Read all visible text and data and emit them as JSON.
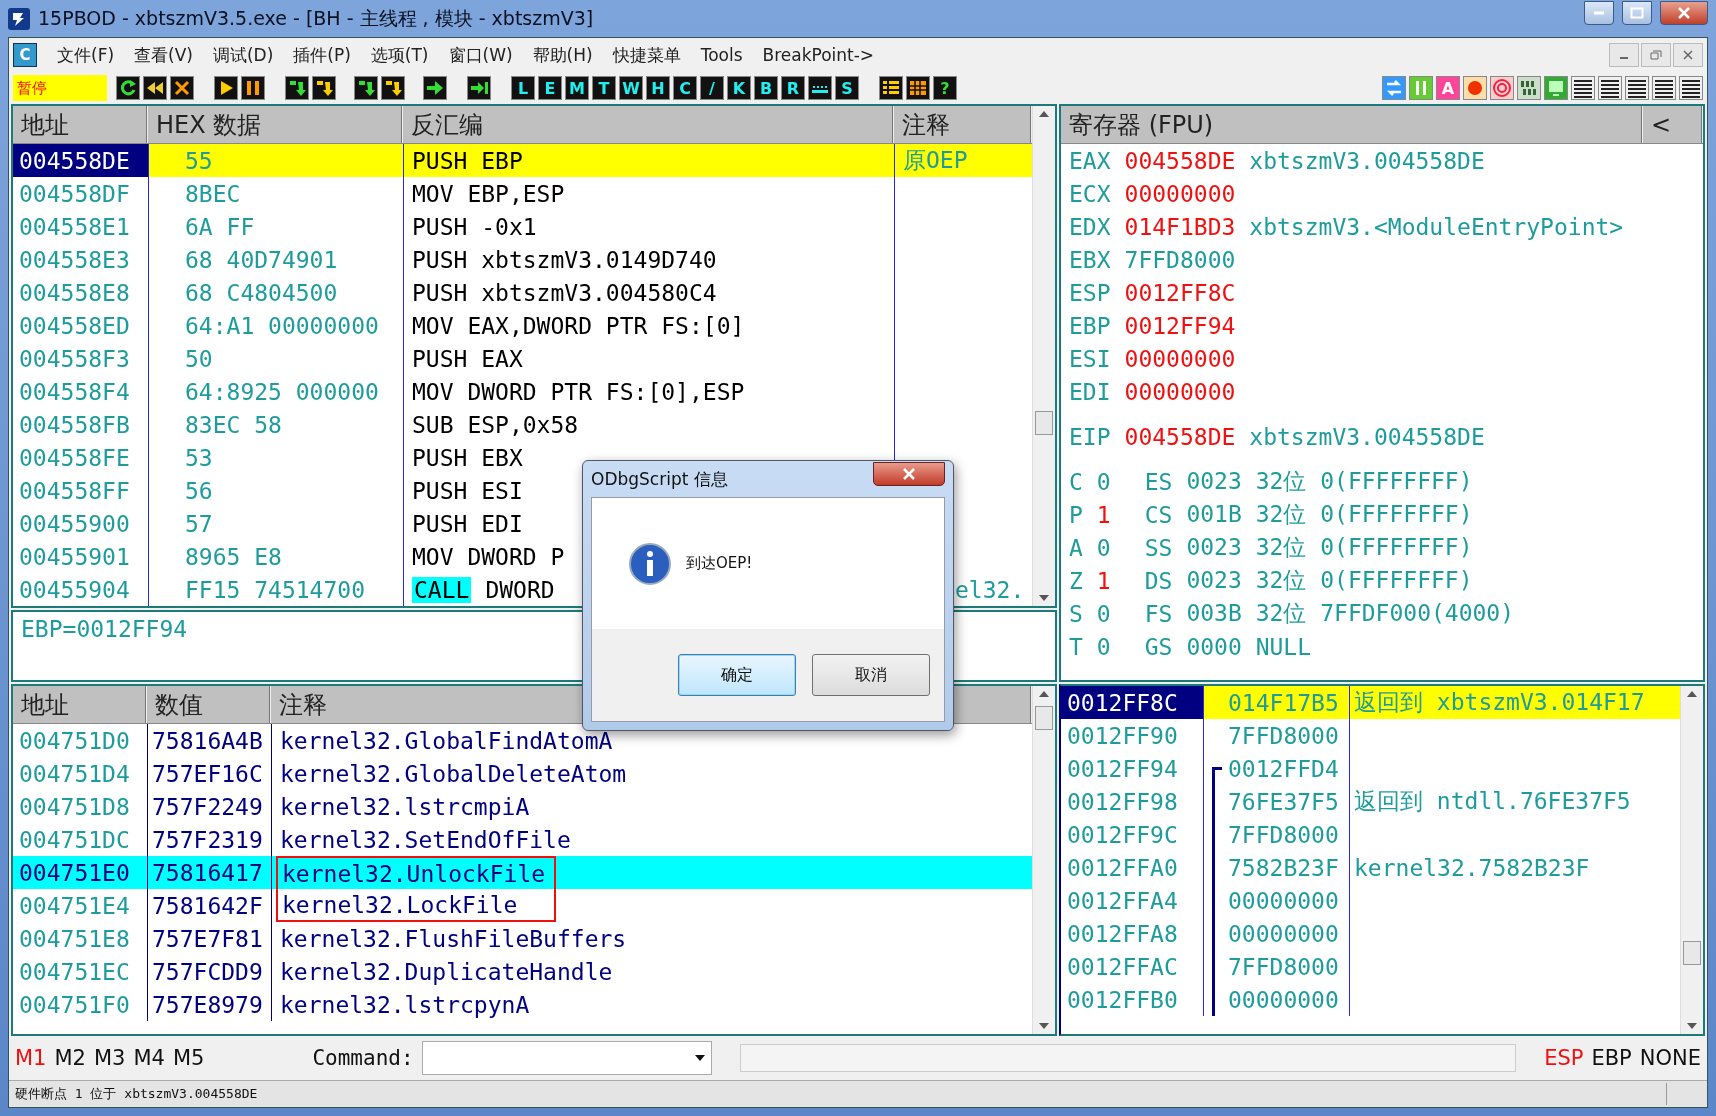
{
  "window": {
    "title": "15PBOD  - xbtszmV3.5.exe - [BH - 主线程 , 模块 - xbtszmV3]"
  },
  "menu": {
    "app_icon": "C",
    "items": [
      "文件(F)",
      "查看(V)",
      "调试(D)",
      "插件(P)",
      "选项(T)",
      "窗口(W)",
      "帮助(H)",
      "快捷菜单",
      "Tools",
      "BreakPoint->"
    ]
  },
  "toolbar": {
    "status": "暂停",
    "letters": [
      "L",
      "E",
      "M",
      "T",
      "W",
      "H",
      "C",
      "/",
      "K",
      "B",
      "R",
      "S"
    ],
    "help": "?",
    "right_letter": "A"
  },
  "disassembly": {
    "columns": [
      "地址",
      "HEX 数据",
      "反汇编",
      "注释"
    ],
    "rows": [
      {
        "address": "004558DE",
        "hex": "55",
        "disasm": "PUSH EBP",
        "comment": "原OEP",
        "selected": true
      },
      {
        "address": "004558DF",
        "hex": "8BEC",
        "disasm": "MOV EBP,ESP",
        "selected": false
      },
      {
        "address": "004558E1",
        "hex": "6A FF",
        "disasm": "PUSH -0x1",
        "selected": false
      },
      {
        "address": "004558E3",
        "hex": "68 40D74901",
        "disasm": "PUSH xbtszmV3.0149D740",
        "selected": false
      },
      {
        "address": "004558E8",
        "hex": "68 C4804500",
        "disasm": "PUSH xbtszmV3.004580C4",
        "selected": false
      },
      {
        "address": "004558ED",
        "hex": "64:A1 00000000",
        "disasm": "MOV EAX,DWORD PTR FS:[0]",
        "selected": false
      },
      {
        "address": "004558F3",
        "hex": "50",
        "disasm": "PUSH EAX",
        "selected": false
      },
      {
        "address": "004558F4",
        "hex": "64:8925 000000",
        "disasm": "MOV DWORD PTR FS:[0],ESP",
        "selected": false
      },
      {
        "address": "004558FB",
        "hex": "83EC 58",
        "disasm": "SUB ESP,0x58",
        "selected": false
      },
      {
        "address": "004558FE",
        "hex": "53",
        "disasm": "PUSH EBX",
        "selected": false
      },
      {
        "address": "004558FF",
        "hex": "56",
        "disasm": "PUSH ESI",
        "selected": false
      },
      {
        "address": "00455900",
        "hex": "57",
        "disasm": "PUSH EDI",
        "selected": false
      },
      {
        "address": "00455901",
        "hex": "8965 E8",
        "disasm": "MOV DWORD P",
        "selected": false
      },
      {
        "address": "00455904",
        "hex": "FF15 74514700",
        "opcode": "CALL",
        "disasm": "DWORD",
        "comment": "el32.",
        "selected": false
      }
    ]
  },
  "info": "EBP=0012FF94",
  "registers": {
    "header": "寄存器 (FPU)",
    "collapse": "<",
    "general": [
      {
        "name": "EAX",
        "value": "004558DE",
        "changed": true,
        "comment": "xbtszmV3.004558DE"
      },
      {
        "name": "ECX",
        "value": "00000000",
        "changed": true
      },
      {
        "name": "EDX",
        "value": "014F1BD3",
        "changed": true,
        "comment": "xbtszmV3.<ModuleEntryPoint>"
      },
      {
        "name": "EBX",
        "value": "7FFD8000",
        "changed": false
      },
      {
        "name": "ESP",
        "value": "0012FF8C",
        "changed": true
      },
      {
        "name": "EBP",
        "value": "0012FF94",
        "changed": true
      },
      {
        "name": "ESI",
        "value": "00000000",
        "changed": true
      },
      {
        "name": "EDI",
        "value": "00000000",
        "changed": true
      }
    ],
    "eip": {
      "name": "EIP",
      "value": "004558DE",
      "changed": true,
      "comment": "xbtszmV3.004558DE"
    },
    "flags": [
      {
        "flag": "C",
        "value": "0",
        "changed": false,
        "segment": "ES",
        "detail": "0023 32位 0(FFFFFFFF)"
      },
      {
        "flag": "P",
        "value": "1",
        "changed": true,
        "segment": "CS",
        "detail": "001B 32位 0(FFFFFFFF)"
      },
      {
        "flag": "A",
        "value": "0",
        "changed": false,
        "segment": "SS",
        "detail": "0023 32位 0(FFFFFFFF)"
      },
      {
        "flag": "Z",
        "value": "1",
        "changed": true,
        "segment": "DS",
        "detail": "0023 32位 0(FFFFFFFF)"
      },
      {
        "flag": "S",
        "value": "0",
        "changed": false,
        "segment": "FS",
        "detail": "003B 32位 7FFDF000(4000)"
      },
      {
        "flag": "T",
        "value": "0",
        "changed": false,
        "segment": "GS",
        "detail": "0000 NULL"
      }
    ]
  },
  "dump": {
    "columns": [
      "地址",
      "数值",
      "注释"
    ],
    "rows": [
      {
        "address": "004751D0",
        "value": "75816A4B",
        "comment": "kernel32.GlobalFindAtomA",
        "selected": false,
        "boxed": false
      },
      {
        "address": "004751D4",
        "value": "757EF16C",
        "comment": "kernel32.GlobalDeleteAtom",
        "selected": false,
        "boxed": false
      },
      {
        "address": "004751D8",
        "value": "757F2249",
        "comment": "kernel32.lstrcmpiA",
        "selected": false,
        "boxed": false
      },
      {
        "address": "004751DC",
        "value": "757F2319",
        "comment": "kernel32.SetEndOfFile",
        "selected": false,
        "boxed": false
      },
      {
        "address": "004751E0",
        "value": "75816417",
        "comment": "kernel32.UnlockFile",
        "selected": true,
        "boxed": true
      },
      {
        "address": "004751E4",
        "value": "7581642F",
        "comment": "kernel32.LockFile",
        "selected": false,
        "boxed": true
      },
      {
        "address": "004751E8",
        "value": "757E7F81",
        "comment": "kernel32.FlushFileBuffers",
        "selected": false,
        "boxed": false
      },
      {
        "address": "004751EC",
        "value": "757FCDD9",
        "comment": "kernel32.DuplicateHandle",
        "selected": false,
        "boxed": false
      },
      {
        "address": "004751F0",
        "value": "757E8979",
        "comment": "kernel32.lstrcpynA",
        "selected": false,
        "boxed": false
      }
    ]
  },
  "stack": {
    "rows": [
      {
        "address": "0012FF8C",
        "value": "014F17B5",
        "comment": "返回到 xbtszmV3.014F17",
        "selected": true,
        "frame_start": false
      },
      {
        "address": "0012FF90",
        "value": "7FFD8000",
        "selected": false,
        "frame_start": false
      },
      {
        "address": "0012FF94",
        "value": "0012FFD4",
        "selected": false,
        "frame_start": true
      },
      {
        "address": "0012FF98",
        "value": "76FE37F5",
        "comment": "返回到 ntdll.76FE37F5",
        "selected": false,
        "frame_start": false
      },
      {
        "address": "0012FF9C",
        "value": "7FFD8000",
        "selected": false,
        "frame_start": false
      },
      {
        "address": "0012FFA0",
        "value": "7582B23F",
        "comment": "kernel32.7582B23F",
        "selected": false,
        "frame_start": false
      },
      {
        "address": "0012FFA4",
        "value": "00000000",
        "selected": false,
        "frame_start": false
      },
      {
        "address": "0012FFA8",
        "value": "00000000",
        "selected": false,
        "frame_start": false
      },
      {
        "address": "0012FFAC",
        "value": "7FFD8000",
        "selected": false,
        "frame_start": false
      },
      {
        "address": "0012FFB0",
        "value": "00000000",
        "selected": false,
        "frame_start": false
      }
    ]
  },
  "bottom": {
    "marks": [
      {
        "label": "M1",
        "selected": true
      },
      {
        "label": "M2",
        "selected": false
      },
      {
        "label": "M3",
        "selected": false
      },
      {
        "label": "M4",
        "selected": false
      },
      {
        "label": "M5",
        "selected": false
      }
    ],
    "command_label": "Command:",
    "modes": [
      {
        "label": "ESP",
        "selected": true
      },
      {
        "label": "EBP",
        "selected": false
      },
      {
        "label": "NONE",
        "selected": false
      }
    ]
  },
  "status_bar": "硬件断点 1 位于 xbtszmV3.004558DE",
  "dialog": {
    "title": "ODbgScript 信息",
    "message": "到达OEP!",
    "buttons": [
      {
        "label": "确定",
        "selected": true
      },
      {
        "label": "取消",
        "selected": false
      }
    ]
  }
}
